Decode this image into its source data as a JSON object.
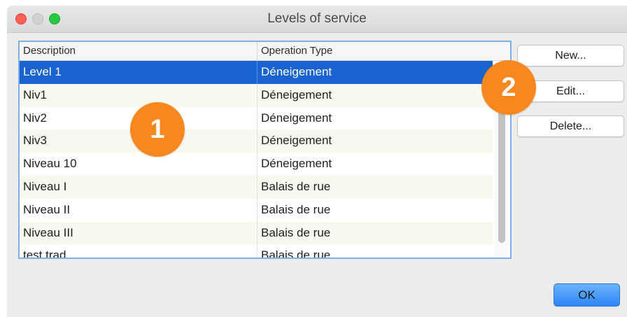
{
  "window": {
    "title": "Levels of service"
  },
  "table": {
    "headers": [
      "Description",
      "Operation Type"
    ],
    "rows": [
      [
        "Level 1",
        "Déneigement"
      ],
      [
        "Niv1",
        "Déneigement"
      ],
      [
        "Niv2",
        "Déneigement"
      ],
      [
        "Niv3",
        "Déneigement"
      ],
      [
        "Niveau 10",
        "Déneigement"
      ],
      [
        "Niveau I",
        "Balais de rue"
      ],
      [
        "Niveau II",
        "Balais de rue"
      ],
      [
        "Niveau III",
        "Balais de rue"
      ],
      [
        "test trad",
        "Balais de rue"
      ]
    ],
    "selected_row": "Level 1"
  },
  "buttons": {
    "new": "New...",
    "edit": "Edit...",
    "delete": "Delete...",
    "ok": "OK"
  },
  "markers": [
    "1",
    "2"
  ],
  "colors": {
    "selection": "#1963d1",
    "marker": "#f7871f",
    "ok_button": "#2c86f6"
  }
}
